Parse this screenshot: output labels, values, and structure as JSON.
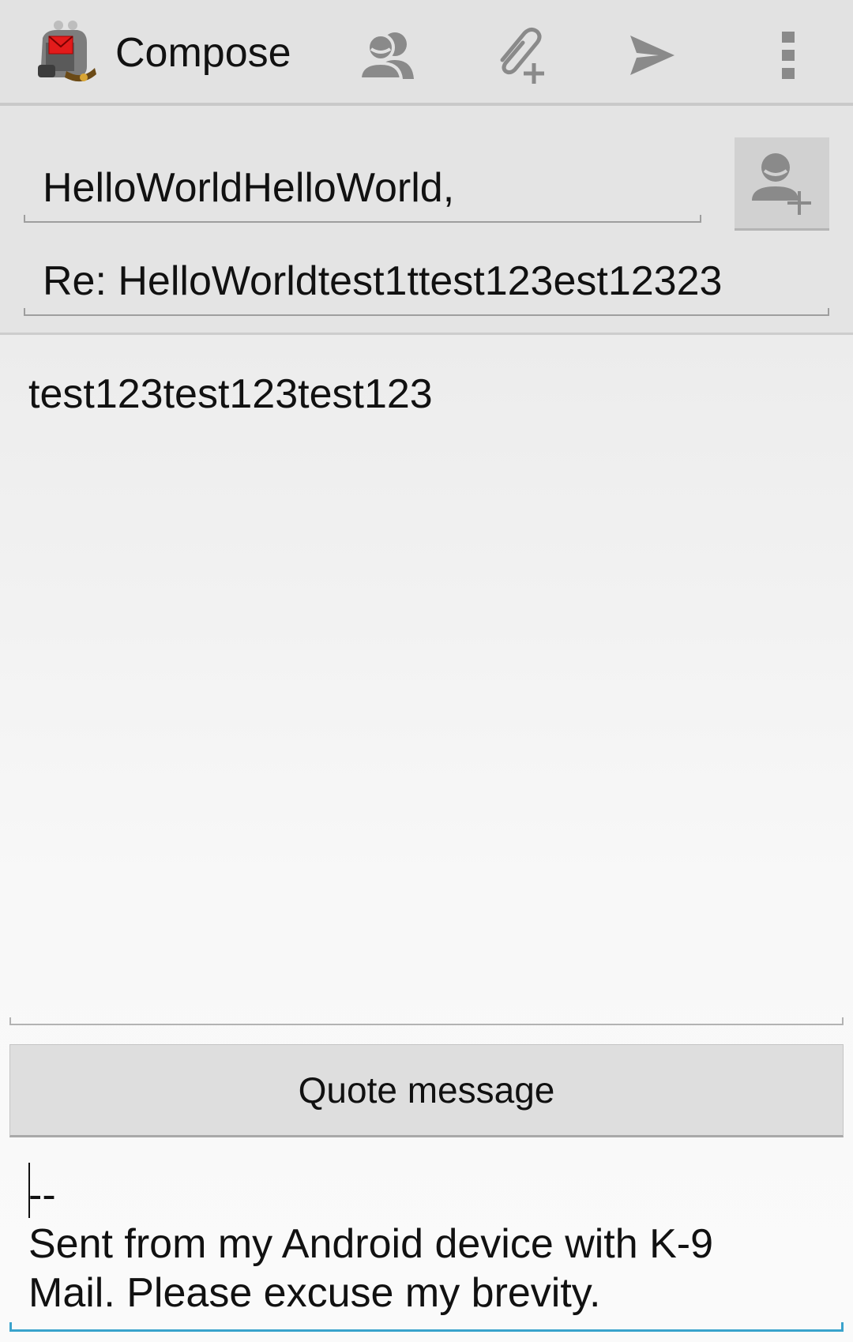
{
  "action_bar": {
    "title": "Compose",
    "icons": {
      "app": "k9-mail-app-icon",
      "contacts": "contacts-icon",
      "attach": "attach-file-icon",
      "send": "send-icon",
      "overflow": "overflow-menu-icon"
    }
  },
  "compose": {
    "to_value": "HelloWorldHelloWorld,",
    "add_contact_icon": "add-contact-icon",
    "subject_value": "Re: HelloWorldtest1ttest123est12323",
    "message_value": "test123test123test123",
    "quote_button_label": "Quote message",
    "signature_dash": "--",
    "signature_text": "Sent from my Android device with K-9 Mail. Please excuse my brevity."
  },
  "colors": {
    "action_bar_bg": "#e2e2e2",
    "header_bg": "#e4e4e4",
    "focus_accent": "#3aa3cc",
    "icon_gray": "#8a8a8a"
  }
}
